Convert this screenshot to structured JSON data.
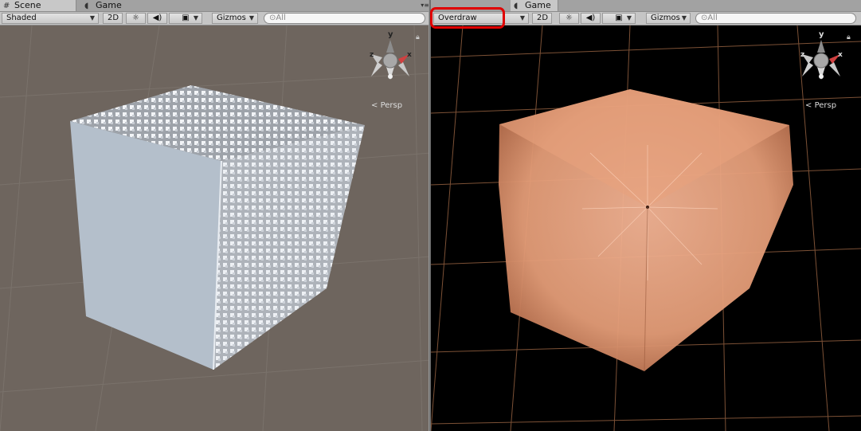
{
  "left_panel": {
    "tabs": [
      {
        "label": "Scene",
        "icon": "grid-icon"
      },
      {
        "label": "Game",
        "icon": "pacman-icon"
      }
    ],
    "toolbar": {
      "draw_mode": "Shaded",
      "mode_2d": "2D",
      "light_icon": "sun-icon",
      "audio_icon": "speaker-icon",
      "effects_icon": "image-icon",
      "gizmos": "Gizmos",
      "search_placeholder": "All"
    },
    "viewport": {
      "background_color": "#6e655e",
      "camera_label": "Persp",
      "axis_y": "y",
      "axis_x": "x",
      "axis_z": "z"
    }
  },
  "right_panel": {
    "tabs": [
      {
        "label": "Game",
        "icon": "pacman-icon"
      }
    ],
    "toolbar": {
      "draw_mode": "Overdraw",
      "mode_2d": "2D",
      "light_icon": "sun-icon",
      "audio_icon": "speaker-icon",
      "effects_icon": "image-icon",
      "gizmos": "Gizmos",
      "search_placeholder": "All"
    },
    "viewport": {
      "background_color": "#000000",
      "overdraw_color": "#e8a07a",
      "camera_label": "Persp",
      "axis_y": "y",
      "axis_x": "x",
      "axis_z": "z"
    }
  },
  "highlight_color": "#e00000"
}
